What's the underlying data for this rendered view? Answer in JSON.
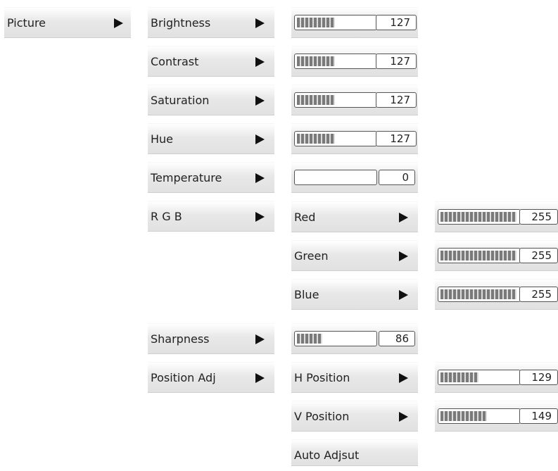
{
  "menu": {
    "picture": {
      "label": "Picture"
    },
    "items": [
      {
        "label": "Brightness",
        "value": 127,
        "max": 255
      },
      {
        "label": "Contrast",
        "value": 127,
        "max": 255
      },
      {
        "label": "Saturation",
        "value": 127,
        "max": 255
      },
      {
        "label": "Hue",
        "value": 127,
        "max": 255
      },
      {
        "label": "Temperature",
        "value": 0,
        "max": 255
      },
      {
        "label": "R G B"
      },
      {
        "label": "Sharpness",
        "value": 86,
        "max": 255
      },
      {
        "label": "Position Adj"
      }
    ],
    "rgb": [
      {
        "label": "Red",
        "value": 255,
        "max": 255
      },
      {
        "label": "Green",
        "value": 255,
        "max": 255
      },
      {
        "label": "Blue",
        "value": 255,
        "max": 255
      }
    ],
    "position": [
      {
        "label": "H Position",
        "value": 129,
        "max": 255
      },
      {
        "label": "V Position",
        "value": 149,
        "max": 255
      },
      {
        "label": "Auto Adjsut"
      }
    ]
  }
}
